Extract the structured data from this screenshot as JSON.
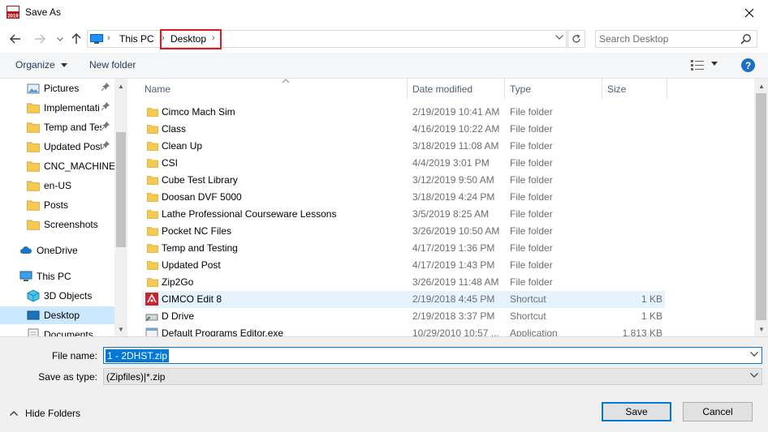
{
  "window": {
    "title": "Save As",
    "app_icon_text": "2019"
  },
  "address": {
    "crumbs": [
      "This PC",
      "Desktop"
    ],
    "search_placeholder": "Search Desktop"
  },
  "toolbar": {
    "organize": "Organize",
    "new_folder": "New folder",
    "help": "?"
  },
  "nav": [
    {
      "label": "Pictures",
      "icon": "pictures-icon",
      "pinned": true
    },
    {
      "label": "Implementati",
      "icon": "folder-icon",
      "pinned": true
    },
    {
      "label": "Temp and Tes",
      "icon": "folder-icon",
      "pinned": true
    },
    {
      "label": "Updated Post",
      "icon": "folder-icon",
      "pinned": true
    },
    {
      "label": "CNC_MACHINES",
      "icon": "folder-icon",
      "pinned": false
    },
    {
      "label": "en-US",
      "icon": "folder-icon",
      "pinned": false
    },
    {
      "label": "Posts",
      "icon": "folder-icon",
      "pinned": false
    },
    {
      "label": "Screenshots",
      "icon": "folder-icon",
      "pinned": false
    },
    {
      "label": "OneDrive",
      "icon": "cloud-icon",
      "pinned": false
    },
    {
      "label": "This PC",
      "icon": "pc-icon",
      "pinned": false
    },
    {
      "label": "3D Objects",
      "icon": "cube-icon",
      "pinned": false
    },
    {
      "label": "Desktop",
      "icon": "desktop-icon",
      "pinned": false,
      "selected": true
    },
    {
      "label": "Documents",
      "icon": "documents-icon",
      "pinned": false
    }
  ],
  "columns": {
    "name": "Name",
    "date": "Date modified",
    "type": "Type",
    "size": "Size"
  },
  "files": [
    {
      "name": "Cimco Mach Sim",
      "date": "2/19/2019 10:41 AM",
      "type": "File folder",
      "size": "",
      "kind": "folder"
    },
    {
      "name": "Class",
      "date": "4/16/2019 10:22 AM",
      "type": "File folder",
      "size": "",
      "kind": "folder"
    },
    {
      "name": "Clean Up",
      "date": "3/18/2019 11:08 AM",
      "type": "File folder",
      "size": "",
      "kind": "folder"
    },
    {
      "name": "CSI",
      "date": "4/4/2019 3:01 PM",
      "type": "File folder",
      "size": "",
      "kind": "folder"
    },
    {
      "name": "Cube Test Library",
      "date": "3/12/2019 9:50 AM",
      "type": "File folder",
      "size": "",
      "kind": "folder"
    },
    {
      "name": "Doosan DVF 5000",
      "date": "3/18/2019 4:24 PM",
      "type": "File folder",
      "size": "",
      "kind": "folder"
    },
    {
      "name": "Lathe Professional Courseware Lessons",
      "date": "3/5/2019 8:25 AM",
      "type": "File folder",
      "size": "",
      "kind": "folder"
    },
    {
      "name": "Pocket NC Files",
      "date": "3/26/2019 10:50 AM",
      "type": "File folder",
      "size": "",
      "kind": "folder"
    },
    {
      "name": "Temp and Testing",
      "date": "4/17/2019 1:36 PM",
      "type": "File folder",
      "size": "",
      "kind": "folder"
    },
    {
      "name": "Updated Post",
      "date": "4/17/2019 1:43 PM",
      "type": "File folder",
      "size": "",
      "kind": "folder"
    },
    {
      "name": "Zip2Go",
      "date": "3/26/2019 11:48 AM",
      "type": "File folder",
      "size": "",
      "kind": "folder"
    },
    {
      "name": "CIMCO Edit 8",
      "date": "2/19/2018 4:45 PM",
      "type": "Shortcut",
      "size": "1 KB",
      "kind": "cimco"
    },
    {
      "name": "D Drive",
      "date": "2/19/2018 3:37 PM",
      "type": "Shortcut",
      "size": "1 KB",
      "kind": "drive"
    },
    {
      "name": "Default Programs Editor.exe",
      "date": "10/29/2010 10:57 ...",
      "type": "Application",
      "size": "1,813 KB",
      "kind": "exe"
    }
  ],
  "bottom": {
    "filename_label": "File name:",
    "filename_value": "1 - 2DHST.zip",
    "savetype_label": "Save as type:",
    "savetype_value": "(Zipfiles)|*.zip",
    "hide_folders": "Hide Folders",
    "save": "Save",
    "cancel": "Cancel"
  },
  "colors": {
    "accent": "#0078d7",
    "selection": "#cce8ff",
    "hover": "#e5f3ff",
    "highlight_box": "#e0161b",
    "folder": "#f6c951"
  }
}
